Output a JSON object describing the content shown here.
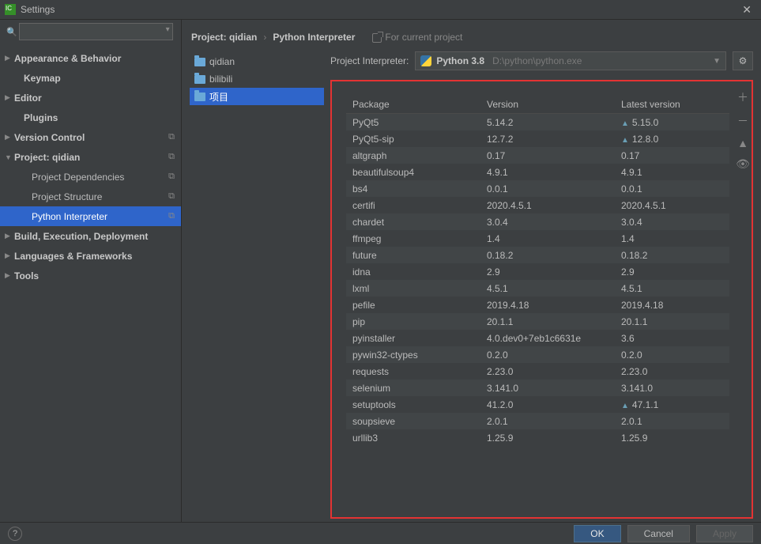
{
  "window": {
    "title": "Settings"
  },
  "search": {
    "placeholder": ""
  },
  "sidebar": [
    {
      "label": "Appearance & Behavior",
      "arrow": "▶",
      "bold": true
    },
    {
      "label": "Keymap",
      "arrow": "",
      "bold": true,
      "sub": true,
      "subpad": 18
    },
    {
      "label": "Editor",
      "arrow": "▶",
      "bold": true
    },
    {
      "label": "Plugins",
      "arrow": "",
      "bold": true,
      "sub": true,
      "subpad": 18
    },
    {
      "label": "Version Control",
      "arrow": "▶",
      "bold": true,
      "copy": true
    },
    {
      "label": "Project: qidian",
      "arrow": "▼",
      "bold": true,
      "copy": true
    },
    {
      "label": "Project Dependencies",
      "arrow": "",
      "bold": false,
      "sub": true,
      "copy": true
    },
    {
      "label": "Project Structure",
      "arrow": "",
      "bold": false,
      "sub": true,
      "copy": true
    },
    {
      "label": "Python Interpreter",
      "arrow": "",
      "bold": false,
      "sub": true,
      "copy": true,
      "selected": true
    },
    {
      "label": "Build, Execution, Deployment",
      "arrow": "▶",
      "bold": true
    },
    {
      "label": "Languages & Frameworks",
      "arrow": "▶",
      "bold": true
    },
    {
      "label": "Tools",
      "arrow": "▶",
      "bold": true
    }
  ],
  "breadcrumb": {
    "a": "Project: qidian",
    "b": "Python Interpreter",
    "note": "For current project"
  },
  "folders": [
    {
      "name": "qidian"
    },
    {
      "name": "bilibili"
    },
    {
      "name": "项目",
      "selected": true
    }
  ],
  "interpreter": {
    "label": "Project Interpreter:",
    "name": "Python 3.8",
    "path": "D:\\python\\python.exe"
  },
  "table": {
    "headers": {
      "package": "Package",
      "version": "Version",
      "latest": "Latest version"
    },
    "rows": [
      {
        "p": "PyQt5",
        "v": "5.14.2",
        "l": "5.15.0",
        "up": true
      },
      {
        "p": "PyQt5-sip",
        "v": "12.7.2",
        "l": "12.8.0",
        "up": true
      },
      {
        "p": "altgraph",
        "v": "0.17",
        "l": "0.17"
      },
      {
        "p": "beautifulsoup4",
        "v": "4.9.1",
        "l": "4.9.1"
      },
      {
        "p": "bs4",
        "v": "0.0.1",
        "l": "0.0.1"
      },
      {
        "p": "certifi",
        "v": "2020.4.5.1",
        "l": "2020.4.5.1"
      },
      {
        "p": "chardet",
        "v": "3.0.4",
        "l": "3.0.4"
      },
      {
        "p": "ffmpeg",
        "v": "1.4",
        "l": "1.4"
      },
      {
        "p": "future",
        "v": "0.18.2",
        "l": "0.18.2"
      },
      {
        "p": "idna",
        "v": "2.9",
        "l": "2.9"
      },
      {
        "p": "lxml",
        "v": "4.5.1",
        "l": "4.5.1"
      },
      {
        "p": "pefile",
        "v": "2019.4.18",
        "l": "2019.4.18"
      },
      {
        "p": "pip",
        "v": "20.1.1",
        "l": "20.1.1"
      },
      {
        "p": "pyinstaller",
        "v": "4.0.dev0+7eb1c6631e",
        "l": "3.6"
      },
      {
        "p": "pywin32-ctypes",
        "v": "0.2.0",
        "l": "0.2.0"
      },
      {
        "p": "requests",
        "v": "2.23.0",
        "l": "2.23.0"
      },
      {
        "p": "selenium",
        "v": "3.141.0",
        "l": "3.141.0"
      },
      {
        "p": "setuptools",
        "v": "41.2.0",
        "l": "47.1.1",
        "up": true
      },
      {
        "p": "soupsieve",
        "v": "2.0.1",
        "l": "2.0.1"
      },
      {
        "p": "urllib3",
        "v": "1.25.9",
        "l": "1.25.9"
      }
    ]
  },
  "buttons": {
    "ok": "OK",
    "cancel": "Cancel",
    "apply": "Apply"
  }
}
